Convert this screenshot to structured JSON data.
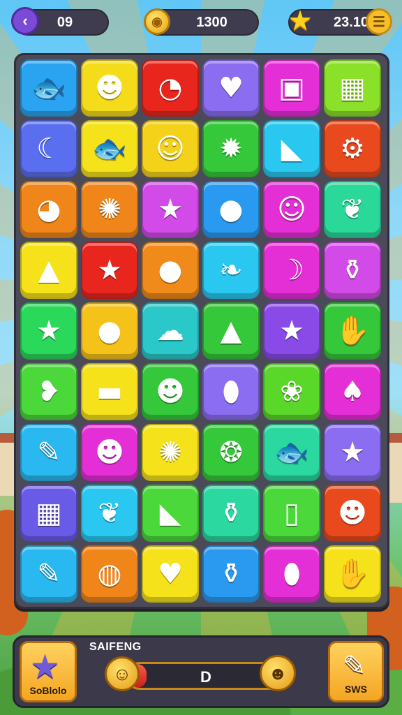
{
  "hud": {
    "moves": "09",
    "coins": "1300",
    "stars": "23.10",
    "back_icon": "back-arrow-icon",
    "menu_icon": "menu-icon"
  },
  "board": {
    "rows": [
      [
        {
          "color": "#2aa3f0",
          "icon": "fish-icon",
          "glyph": "🐟"
        },
        {
          "color": "#f5dc1a",
          "icon": "smile-creature-icon",
          "glyph": "☻"
        },
        {
          "color": "#e8261e",
          "icon": "clock-icon",
          "glyph": "◔"
        },
        {
          "color": "#8a6df0",
          "icon": "heart-icon",
          "glyph": "♥"
        },
        {
          "color": "#e42fd6",
          "icon": "box-face-icon",
          "glyph": "▣"
        },
        {
          "color": "#8be02a",
          "icon": "grid-icon",
          "glyph": "▦"
        }
      ],
      [
        {
          "color": "#5a6ff0",
          "icon": "crescent-icon",
          "glyph": "☾"
        },
        {
          "color": "#f5e21a",
          "icon": "fish-icon",
          "glyph": "🐟"
        },
        {
          "color": "#f5d21a",
          "icon": "face-icon",
          "glyph": "☺"
        },
        {
          "color": "#35c83a",
          "icon": "star-icon",
          "glyph": "✹"
        },
        {
          "color": "#2ac8f0",
          "icon": "flag-icon",
          "glyph": "◣"
        },
        {
          "color": "#e84a1e",
          "icon": "gear-icon",
          "glyph": "⚙"
        }
      ],
      [
        {
          "color": "#f0861a",
          "icon": "bird-icon",
          "glyph": "◕"
        },
        {
          "color": "#f0861a",
          "icon": "gear-icon",
          "glyph": "✺"
        },
        {
          "color": "#d24ae8",
          "icon": "star-icon",
          "glyph": "★"
        },
        {
          "color": "#2a9af0",
          "icon": "blob-icon",
          "glyph": "●"
        },
        {
          "color": "#e42fd6",
          "icon": "smiley-icon",
          "glyph": "☺"
        },
        {
          "color": "#2ad89a",
          "icon": "leaf-icon",
          "glyph": "❦"
        }
      ],
      [
        {
          "color": "#f5e21a",
          "icon": "bottle-icon",
          "glyph": "▲"
        },
        {
          "color": "#e8261e",
          "icon": "star-icon",
          "glyph": "★"
        },
        {
          "color": "#f08a1a",
          "icon": "blob-face-icon",
          "glyph": "●"
        },
        {
          "color": "#2ac8f0",
          "icon": "leaf-icon",
          "glyph": "❧"
        },
        {
          "color": "#e42fd6",
          "icon": "moon-icon",
          "glyph": "☽"
        },
        {
          "color": "#d24ae8",
          "icon": "jar-icon",
          "glyph": "⚱"
        }
      ],
      [
        {
          "color": "#2ad85a",
          "icon": "star-icon",
          "glyph": "★"
        },
        {
          "color": "#f5c21a",
          "icon": "blob-face-icon",
          "glyph": "●"
        },
        {
          "color": "#2ac8c8",
          "icon": "ghost-icon",
          "glyph": "☁"
        },
        {
          "color": "#35c83a",
          "icon": "blob-icon",
          "glyph": "▲"
        },
        {
          "color": "#8a4ae8",
          "icon": "star-icon",
          "glyph": "★"
        },
        {
          "color": "#35c83a",
          "icon": "hand-icon",
          "glyph": "✋"
        }
      ],
      [
        {
          "color": "#4ad83a",
          "icon": "bird-icon",
          "glyph": "❥"
        },
        {
          "color": "#f5e21a",
          "icon": "capsule-icon",
          "glyph": "▬"
        },
        {
          "color": "#35c83a",
          "icon": "smiley-icon",
          "glyph": "☻"
        },
        {
          "color": "#8a6df0",
          "icon": "drop-icon",
          "glyph": "⬮"
        },
        {
          "color": "#5ad82a",
          "icon": "sprout-icon",
          "glyph": "❀"
        },
        {
          "color": "#e42fd6",
          "icon": "tulip-icon",
          "glyph": "♠"
        }
      ],
      [
        {
          "color": "#2ab8f0",
          "icon": "pencil-icon",
          "glyph": "✎"
        },
        {
          "color": "#e42fd6",
          "icon": "face-icon",
          "glyph": "☻"
        },
        {
          "color": "#f5e21a",
          "icon": "gear-icon",
          "glyph": "✺"
        },
        {
          "color": "#35c83a",
          "icon": "shell-icon",
          "glyph": "❂"
        },
        {
          "color": "#2ad8a0",
          "icon": "fish-icon",
          "glyph": "🐟"
        },
        {
          "color": "#8a6df0",
          "icon": "star-icon",
          "glyph": "★"
        }
      ],
      [
        {
          "color": "#6a5ae8",
          "icon": "grid-icon",
          "glyph": "▦"
        },
        {
          "color": "#2ac8f0",
          "icon": "leaf-icon",
          "glyph": "❦"
        },
        {
          "color": "#4ad83a",
          "icon": "triangle-icon",
          "glyph": "◣"
        },
        {
          "color": "#2ad8a0",
          "icon": "jar-icon",
          "glyph": "⚱"
        },
        {
          "color": "#4ad83a",
          "icon": "bottle-icon",
          "glyph": "▯"
        },
        {
          "color": "#e84a1e",
          "icon": "frog-icon",
          "glyph": "☻"
        }
      ],
      [
        {
          "color": "#2ab8f0",
          "icon": "horn-icon",
          "glyph": "✎"
        },
        {
          "color": "#f0861a",
          "icon": "bubble-icon",
          "glyph": "◍"
        },
        {
          "color": "#f5e21a",
          "icon": "heart-icon",
          "glyph": "♥"
        },
        {
          "color": "#2a9af0",
          "icon": "jar-icon",
          "glyph": "⚱"
        },
        {
          "color": "#e42fd6",
          "icon": "drop-icon",
          "glyph": "⬮"
        },
        {
          "color": "#f5e21a",
          "icon": "hand-icon",
          "glyph": "✋"
        }
      ]
    ]
  },
  "bottom": {
    "progress_title": "SAIFENG",
    "progress_value": "D",
    "progress_fraction": 0.12,
    "left_booster_label": "SoBlolo",
    "left_booster_icon": "star-icon",
    "right_booster_label": "SWS",
    "right_booster_icon": "pencil-icon",
    "mascot_left_icon": "mascot-icon",
    "mascot_right_icon": "mascot-icon"
  }
}
